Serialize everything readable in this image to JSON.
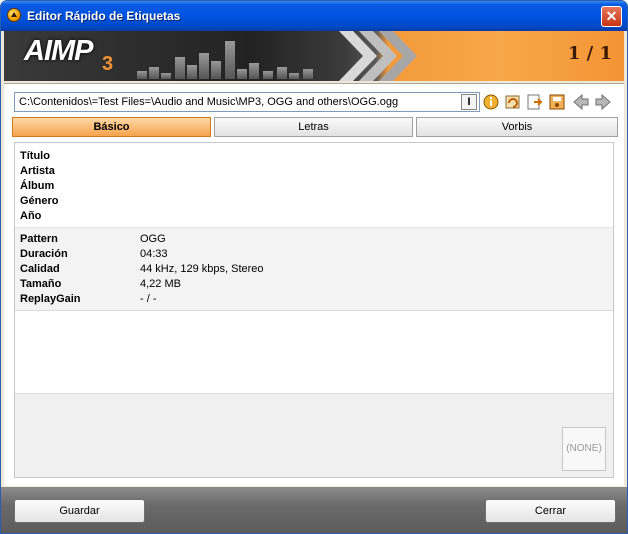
{
  "window": {
    "title": "Editor Rápido de Etiquetas"
  },
  "banner": {
    "logo": "AIMP",
    "logo_suffix": "3",
    "counter": "1 / 1"
  },
  "toolbar": {
    "path": "C:\\Contenidos\\=Test Files=\\Audio and Music\\MP3, OGG and others\\OGG.ogg",
    "path_button": "I",
    "icons": [
      "info-icon",
      "reload-icon",
      "export-icon",
      "save-tag-icon",
      "back-arrow-icon",
      "forward-arrow-icon"
    ]
  },
  "tabs": [
    {
      "label": "Básico",
      "active": true
    },
    {
      "label": "Letras",
      "active": false
    },
    {
      "label": "Vorbis",
      "active": false
    }
  ],
  "tags": {
    "title_label": "Título",
    "artist_label": "Artista",
    "album_label": "Álbum",
    "genre_label": "Género",
    "year_label": "Año"
  },
  "info": {
    "pattern_label": "Pattern",
    "pattern_value": "OGG",
    "duration_label": "Duración",
    "duration_value": "04:33",
    "quality_label": "Calidad",
    "quality_value": "44 kHz, 129 kbps, Stereo",
    "size_label": "Tamaño",
    "size_value": "4,22 MB",
    "replaygain_label": "ReplayGain",
    "replaygain_value": "- / -"
  },
  "cover": {
    "label": "(NONE)"
  },
  "footer": {
    "save_label": "Guardar",
    "close_label": "Cerrar"
  },
  "colors": {
    "accent": "#f39435",
    "title_bar": "#0054e3",
    "active_tab": "#f6a24c"
  }
}
